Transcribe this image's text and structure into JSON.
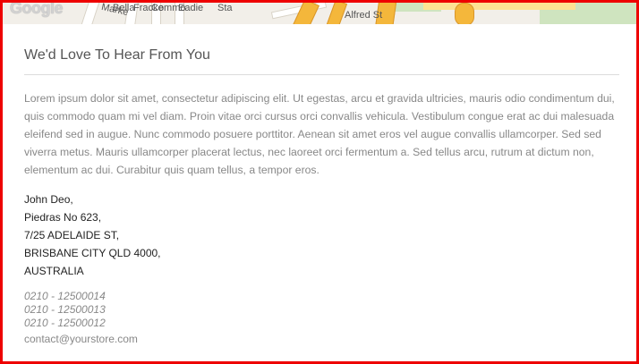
{
  "map": {
    "brand": "Google",
    "street_labels": [
      "Marke",
      "Bella",
      "Fracke",
      "Commo",
      "Eadie",
      "Sta",
      "Alfred St"
    ],
    "colors": {
      "land": "#f2efe9",
      "park": "#cfe4bf",
      "highway": "#f4b73b"
    }
  },
  "section": {
    "title": "We'd Love To Hear From You",
    "intro": "Lorem ipsum dolor sit amet, consectetur adipiscing elit. Ut egestas, arcu et gravida ultricies, mauris odio condimentum dui, quis commodo quam mi vel diam. Proin vitae orci cursus orci convallis vehicula. Vestibulum congue erat ac dui malesuada eleifend sed in augue. Nunc commodo posuere porttitor. Aenean sit amet eros vel augue convallis ullamcorper. Sed sed viverra metus. Mauris ullamcorper placerat lectus, nec laoreet orci fermentum a. Sed tellus arcu, rutrum at dictum non, elementum ac dui. Curabitur quis quam tellus, a tempor eros."
  },
  "address": {
    "lines": [
      "John Deo,",
      "Piedras No 623,",
      "7/25 ADELAIDE ST,",
      "BRISBANE CITY QLD 4000,",
      "AUSTRALIA"
    ]
  },
  "contact": {
    "phones": [
      "0210 - 12500014",
      "0210 - 12500013",
      "0210 - 12500012"
    ],
    "email": "contact@yourstore.com"
  },
  "colors": {
    "frame_border": "#ee0000",
    "title": "#555555",
    "body_text": "#888888"
  }
}
